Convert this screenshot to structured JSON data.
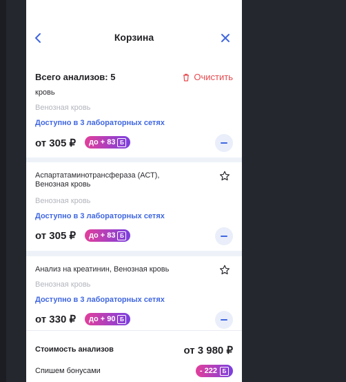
{
  "header": {
    "title": "Корзина"
  },
  "summary": {
    "total_label": "Всего анализов: 5",
    "clear_label": "Очистить"
  },
  "cards": [
    {
      "name": "кровь",
      "sub": "Венозная кровь",
      "availability": "Доступно в 3 лабораторных сетях",
      "price": "от 305 ₽",
      "bonus": "до + 83"
    },
    {
      "name": "Аспартатаминотрансфераза (АСТ), Венозная кровь",
      "sub": "Венозная кровь",
      "availability": "Доступно в 3 лабораторных сетях",
      "price": "от 305 ₽",
      "bonus": "до + 83"
    },
    {
      "name": "Анализ на креатинин, Венозная кровь",
      "sub": "Венозная кровь",
      "availability": "Доступно в 3 лабораторных сетях",
      "price": "от 330 ₽",
      "bonus": "до + 90"
    }
  ],
  "footer": {
    "cost_label": "Стоимость анализов",
    "cost_value": "от 3 980 ₽",
    "bonus_label": "Спишем бонусами",
    "bonus_value": "- 222"
  },
  "icons": {
    "bonus_letter": "Б"
  },
  "colors": {
    "accent": "#3f66e0",
    "danger": "#e5484d",
    "badge_start": "#e23f9a",
    "badge_end": "#7a3fe0"
  }
}
